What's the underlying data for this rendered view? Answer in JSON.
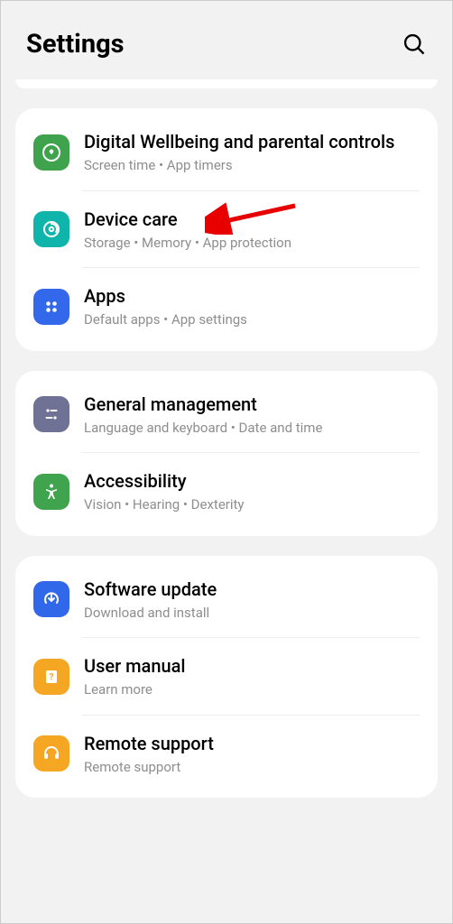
{
  "header": {
    "title": "Settings"
  },
  "groups": [
    {
      "items": [
        {
          "id": "digital-wellbeing",
          "title": "Digital Wellbeing and parental controls",
          "sub": "Screen time  •  App timers",
          "iconColor": "#3ea34c"
        },
        {
          "id": "device-care",
          "title": "Device care",
          "sub": "Storage  •  Memory  •  App protection",
          "iconColor": "#0fb5aa"
        },
        {
          "id": "apps",
          "title": "Apps",
          "sub": "Default apps  •  App settings",
          "iconColor": "#3268e9"
        }
      ]
    },
    {
      "items": [
        {
          "id": "general-management",
          "title": "General management",
          "sub": "Language and keyboard  •  Date and time",
          "iconColor": "#6f7195"
        },
        {
          "id": "accessibility",
          "title": "Accessibility",
          "sub": "Vision  •  Hearing  •  Dexterity",
          "iconColor": "#3fa44d"
        }
      ]
    },
    {
      "items": [
        {
          "id": "software-update",
          "title": "Software update",
          "sub": "Download and install",
          "iconColor": "#3168e9"
        },
        {
          "id": "user-manual",
          "title": "User manual",
          "sub": "Learn more",
          "iconColor": "#f5a623"
        },
        {
          "id": "remote-support",
          "title": "Remote support",
          "sub": "Remote support",
          "iconColor": "#f5a623"
        }
      ]
    }
  ],
  "annotation": {
    "target": "device-care",
    "color": "#e80000"
  }
}
